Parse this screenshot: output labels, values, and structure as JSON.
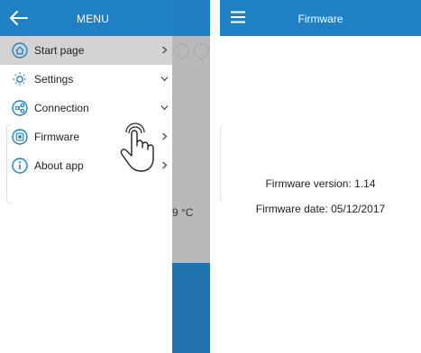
{
  "left": {
    "menu_title": "MENU",
    "items": [
      {
        "label": "Start page",
        "icon": "home-icon",
        "chevron": "right"
      },
      {
        "label": "Settings",
        "icon": "settings-icon",
        "chevron": "down"
      },
      {
        "label": "Connection",
        "icon": "share-icon",
        "chevron": "down"
      },
      {
        "label": "Firmware",
        "icon": "chip-icon",
        "chevron": "right"
      },
      {
        "label": "About app",
        "icon": "info-icon",
        "chevron": "right"
      }
    ],
    "background_temp": "9 °C"
  },
  "right": {
    "title": "Firmware",
    "firmware_version": "Firmware version: 1.14",
    "firmware_date": "Firmware date: 05/12/2017"
  },
  "colors": {
    "header_blue": "#1f80c4",
    "icon_blue": "#1f80c4",
    "active_item_bg": "#d3d3d3",
    "overlay_gray": "#b9b9b9",
    "footer_blue": "#2272ad"
  }
}
